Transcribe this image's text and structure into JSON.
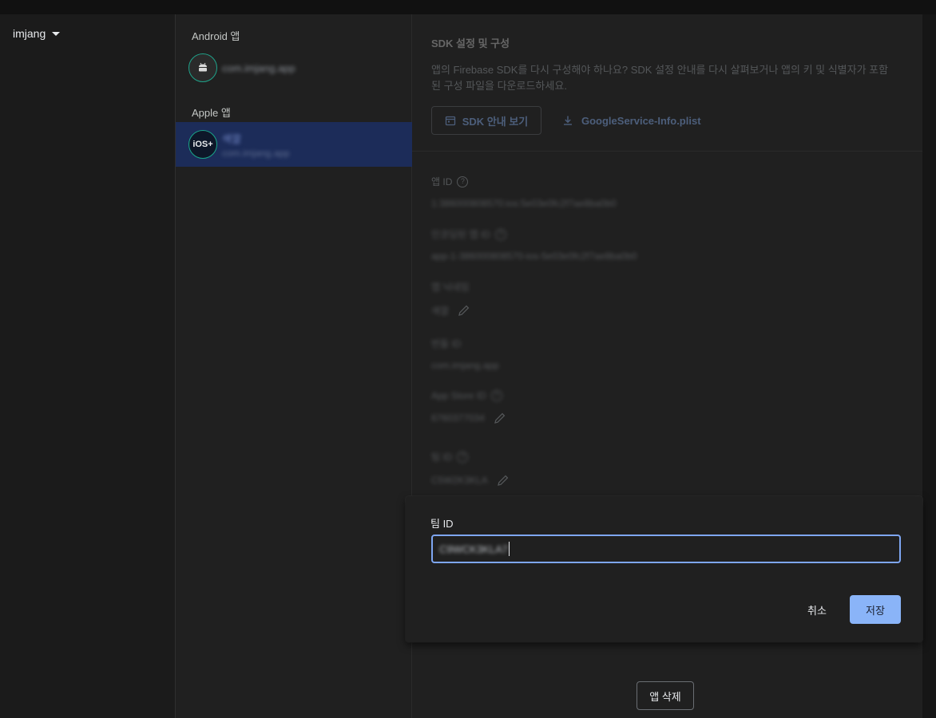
{
  "project": {
    "name": "imjang"
  },
  "apps": {
    "android_label": "Android 앱",
    "android_app": {
      "name": "com.imjang.app",
      "icon": "android-icon"
    },
    "apple_label": "Apple 앱",
    "ios_app": {
      "name": "색깔",
      "bundle": "com.imjang.app",
      "icon": "ios-plus-icon",
      "icon_text": "iOS+"
    }
  },
  "details": {
    "sdk_title": "SDK 설정 및 구성",
    "sdk_desc": "앱의 Firebase SDK를 다시 구성해야 하나요? SDK 설정 안내를 다시 살펴보거나 앱의 키 및 식별자가 포함된 구성 파일을 다운로드하세요.",
    "sdk_button": "SDK 안내 보기",
    "download_link": "GoogleService-Info.plist",
    "fields": [
      {
        "label": "앱 ID",
        "value": "1:386000808570:ios:5e03e0fc2f7ae8ba0b0",
        "help": true,
        "edit": false
      },
      {
        "label": "인코딩된 앱 ID",
        "value": "app-1-386000808570-ios-5e03e0fc2f7ae8ba0b0",
        "help": true,
        "edit": false
      },
      {
        "label": "앱 닉네임",
        "value": "색깔",
        "help": false,
        "edit": true
      },
      {
        "label": "번들 ID",
        "value": "com.imjang.app",
        "help": false,
        "edit": false
      },
      {
        "label": "App Store ID",
        "value": "6760377034",
        "help": true,
        "edit": true
      },
      {
        "label": "팀 ID",
        "value": "C5W2K3KLA",
        "help": true,
        "edit": true
      }
    ]
  },
  "popover": {
    "label": "팀 ID",
    "value": "C9WCK3KLA7",
    "cancel": "취소",
    "save": "저장"
  },
  "delete_button": "앱 삭제",
  "colors": {
    "accent": "#8ab4f8",
    "selected_row": "#1c2c59",
    "icon_ring": "#1fa38a"
  }
}
